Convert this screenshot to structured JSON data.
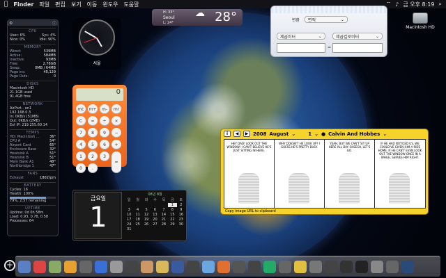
{
  "menubar": {
    "apple": "",
    "app": "Finder",
    "items": [
      "파일",
      "편집",
      "보기",
      "이동",
      "윈도우",
      "도움말"
    ],
    "clock": "금 오후 8:19"
  },
  "stats": {
    "cpu": {
      "title": "CPU",
      "user": "User: 6%",
      "sys": "Sys: 4%",
      "nice": "Nice: 0%",
      "idle": "Idle: 90%"
    },
    "memory": {
      "title": "MEMORY",
      "rows": [
        [
          "Wired:",
          "539MB"
        ],
        [
          "Active:",
          "584MB"
        ],
        [
          "Inactive:",
          "93MB"
        ],
        [
          "Free:",
          "2.78GB"
        ],
        [
          "Swap:",
          "0MB / 64MB"
        ],
        [
          "Page ins:",
          "40,129"
        ],
        [
          "Page Outs:",
          "0"
        ]
      ]
    },
    "disks": {
      "title": "DISKS",
      "name": "Macintosh HD",
      "used": "21.1GB used",
      "free": "91.4GB free"
    },
    "network": {
      "title": "NETWORK",
      "iface": "AirPort - en1",
      "ip": "192.168.0.3",
      "in": "In: 0KB/s (51MB)",
      "out": "Out: 0KB/s (2MB)",
      "ext": "Ext IP: 219.255.60.14"
    },
    "temps": {
      "title": "TEMPS",
      "rows": [
        [
          "HD: Macintosh ...",
          "36°"
        ],
        [
          "CPU A",
          "54°"
        ],
        [
          "Airport Card",
          "65°"
        ],
        [
          "Enclosure Base",
          "32°"
        ],
        [
          "Heatsink A",
          "51°"
        ],
        [
          "Heatsink B",
          "51°"
        ],
        [
          "Mem Bank A1",
          "48°"
        ],
        [
          "Northbridge 1",
          "47°"
        ]
      ]
    },
    "fans": {
      "title": "FANS",
      "label": "Exhaust",
      "value": "1802rpm"
    },
    "battery": {
      "title": "BATTERY",
      "cycles": "Cycles: 16",
      "health": "Health: 100%",
      "remaining": "79%, 2:57 remaining",
      "level": 0.79
    },
    "uptime": {
      "title": "UPTIME",
      "uptime": "Uptime: 0d 0h 58m",
      "load": "Load: 0.93, 0.78, 0.58",
      "processes": "Processes: 64"
    }
  },
  "clock": {
    "city": "서울"
  },
  "weather": {
    "hi": "H: 33°",
    "city": "Seoul",
    "lo": "L: 24°",
    "temp": "28°"
  },
  "calculator": {
    "display": "0",
    "keys": [
      "mc",
      "m+",
      "m-",
      "mr",
      "C",
      "=",
      "÷",
      "×",
      "7",
      "8",
      "9",
      "−",
      "4",
      "5",
      "6",
      "+",
      "1",
      "2",
      "3",
      "0",
      "."
    ]
  },
  "converter": {
    "label": "변환",
    "category": "면적",
    "from_unit": "제곱미터",
    "to_unit": "제곱킬로미터",
    "equals": "="
  },
  "desktop": {
    "hd_label": "Macintosh HD"
  },
  "comic": {
    "year": "2008",
    "month": "August",
    "day": "1",
    "title": "Calvin And Hobbes",
    "footer": "Copy image URL to clipboard",
    "panels": [
      "HEY DAD! LOOK OUT THE WINDOW! I CAN'T BELIEVE HE'S JUST SITTING IN HERE.",
      "WHY DOESN'T HE LOOK UP? I GUESS HE'S PRETTY BUSY.",
      "YEAH, BUT WE CAN'T SIT UP HERE ALL DAY. SHEESH, LET'S GO.",
      "IF HE HAD NOTICED US, WE COULD'VE GIVEN HIM A RIDE HOME. IF HE CAN'T EVEN LOOK OUT THE WINDOW ONCE IN A WHILE, SERVES HIM RIGHT."
    ]
  },
  "datewidget": {
    "weekday": "금요일",
    "daynum": "1",
    "month_header": "08년 8월",
    "dow": [
      "일",
      "월",
      "화",
      "수",
      "목",
      "금",
      "토"
    ],
    "days": [
      "",
      "",
      "",
      "",
      "",
      "1",
      "2",
      "3",
      "4",
      "5",
      "6",
      "7",
      "8",
      "9",
      "10",
      "11",
      "12",
      "13",
      "14",
      "15",
      "16",
      "17",
      "18",
      "19",
      "20",
      "21",
      "22",
      "23",
      "24",
      "25",
      "26",
      "27",
      "28",
      "29",
      "30",
      "31"
    ]
  },
  "dock_colors": [
    "#5a7fc4",
    "#d44",
    "#8a6",
    "#e8a030",
    "#666",
    "#3a6fd8",
    "#999",
    "#444",
    "#c96",
    "#d8b85a",
    "#3a5aa0",
    "#444",
    "#6aa6e0",
    "#e07030",
    "#555",
    "#444",
    "#2a6",
    "#666",
    "#e0c040",
    "#777",
    "#444",
    "#333",
    "#222",
    "#888",
    "#666",
    "#2a4a7a"
  ]
}
